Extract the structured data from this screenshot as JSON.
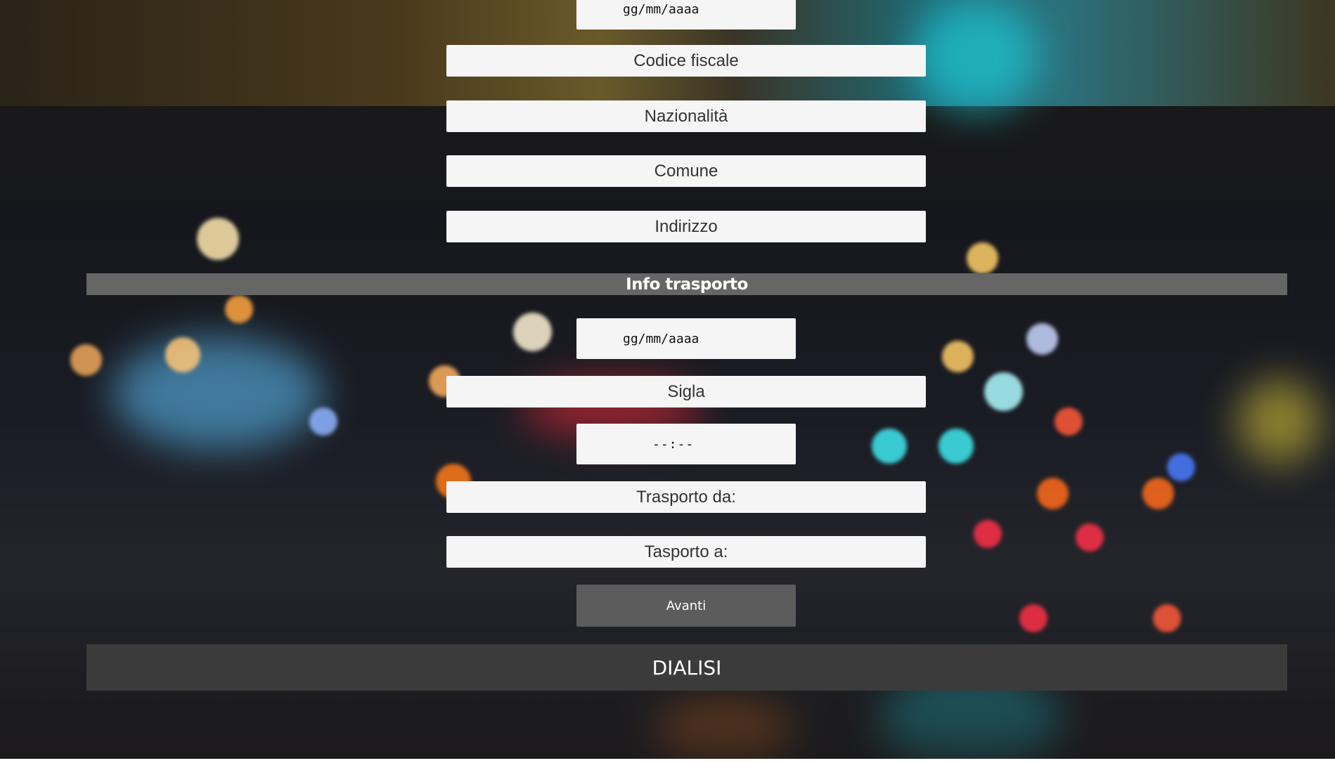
{
  "personal": {
    "birth_date_placeholder": "gg/mm/aaaa",
    "tax_code_placeholder": "Codice fiscale",
    "nationality_placeholder": "Nazionalità",
    "municipality_placeholder": "Comune",
    "address_placeholder": "Indirizzo"
  },
  "transport": {
    "section_title": "Info trasporto",
    "date_placeholder": "gg/mm/aaaa",
    "code_placeholder": "Sigla",
    "time_placeholder": "--:--",
    "from_placeholder": "Trasporto da:",
    "to_placeholder": "Tasporto a:",
    "next_label": "Avanti"
  },
  "footer": {
    "title": "DIALISI"
  }
}
